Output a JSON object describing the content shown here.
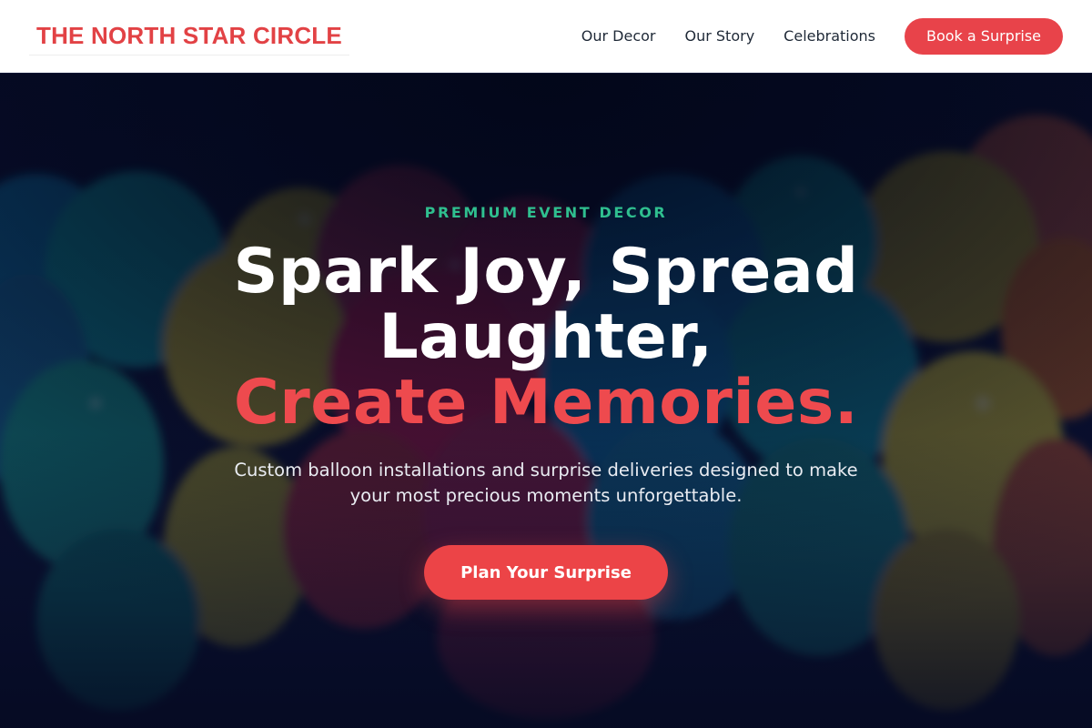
{
  "header": {
    "brand": "THE NORTH STAR CIRCLE",
    "nav": [
      {
        "label": "Our Decor"
      },
      {
        "label": "Our Story"
      },
      {
        "label": "Celebrations"
      }
    ],
    "cta_label": "Book a Surprise"
  },
  "hero": {
    "eyebrow": "PREMIUM EVENT DECOR",
    "headline_line1": "Spark Joy, Spread Laughter,",
    "headline_accent": "Create Memories.",
    "subtitle": "Custom balloon installations and surprise deliveries designed to make your most precious moments unforgettable.",
    "cta_label": "Plan Your Surprise"
  },
  "colors": {
    "brand": "#e24245",
    "accent": "#ec4447",
    "eyebrow": "#2fbf8f",
    "overlay": "#0b1230"
  },
  "background": {
    "subject": "colorful balloons",
    "icon": "balloon-photo"
  }
}
